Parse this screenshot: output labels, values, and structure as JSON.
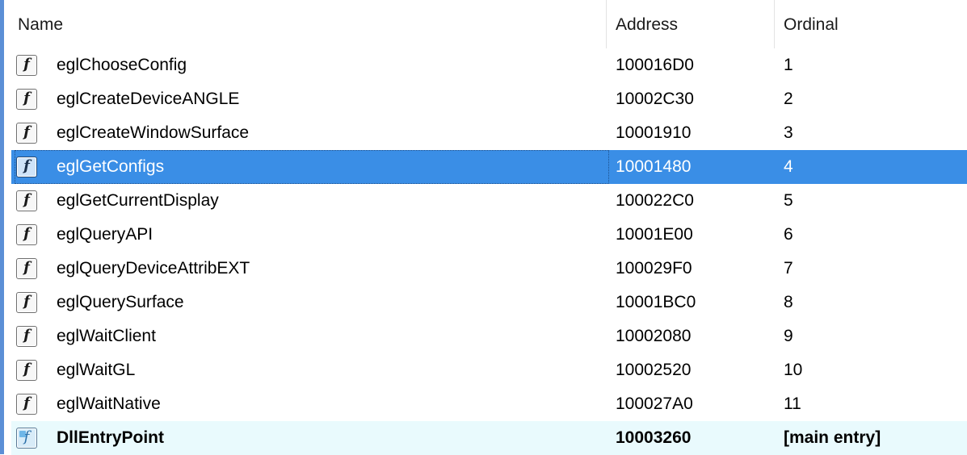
{
  "columns": {
    "name": "Name",
    "address": "Address",
    "ordinal": "Ordinal"
  },
  "icons": {
    "function": "function-icon",
    "entry": "entry-point-icon",
    "glyph": "f"
  },
  "colors": {
    "selection": "#3a8ee6",
    "entry_row": "#e9fafd",
    "left_bar": "#5b8fd6"
  },
  "rows": [
    {
      "name": "eglChooseConfig",
      "address": "100016D0",
      "ordinal": "1"
    },
    {
      "name": "eglCreateDeviceANGLE",
      "address": "10002C30",
      "ordinal": "2"
    },
    {
      "name": "eglCreateWindowSurface",
      "address": "10001910",
      "ordinal": "3"
    },
    {
      "name": "eglGetConfigs",
      "address": "10001480",
      "ordinal": "4",
      "selected": true
    },
    {
      "name": "eglGetCurrentDisplay",
      "address": "100022C0",
      "ordinal": "5"
    },
    {
      "name": "eglQueryAPI",
      "address": "10001E00",
      "ordinal": "6"
    },
    {
      "name": "eglQueryDeviceAttribEXT",
      "address": "100029F0",
      "ordinal": "7"
    },
    {
      "name": "eglQuerySurface",
      "address": "10001BC0",
      "ordinal": "8"
    },
    {
      "name": "eglWaitClient",
      "address": "10002080",
      "ordinal": "9"
    },
    {
      "name": "eglWaitGL",
      "address": "10002520",
      "ordinal": "10"
    },
    {
      "name": "eglWaitNative",
      "address": "100027A0",
      "ordinal": "11"
    },
    {
      "name": "DllEntryPoint",
      "address": "10003260",
      "ordinal": "[main entry]"
    }
  ]
}
